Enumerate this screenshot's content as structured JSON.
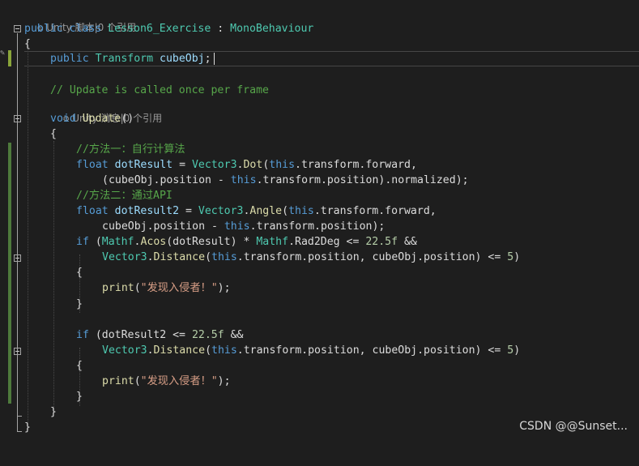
{
  "lens": {
    "class_refs": "Unity 脚本|0 个引用",
    "update_refs": "Unity 消息|0 个引用"
  },
  "code": {
    "class_decl": {
      "kw1": "public",
      "kw2": "class",
      "name": "Lesson6_Exercise",
      "colon": " : ",
      "base": "MonoBehaviour"
    },
    "open_brace": "{",
    "field": {
      "kw": "public",
      "type": "Transform",
      "name": "cubeObj",
      "semi": ";"
    },
    "comment_update": "// Update is called once per frame",
    "method": {
      "kw": "void",
      "name": "Update",
      "parens": "()"
    },
    "method_open": "{",
    "c1": "//方法一：自行计算法",
    "l_dot_1": {
      "kw": "float",
      "var": "dotResult",
      "eq": " = ",
      "type": "Vector3",
      "dot": ".",
      "fn": "Dot",
      "open": "(",
      "this": "this",
      "rest": ".transform.forward,"
    },
    "l_dot_2": {
      "text1": "(cubeObj.position - ",
      "this": "this",
      "text2": ".transform.position).normalized);"
    },
    "c2": "//方法二：通过API",
    "l_ang_1": {
      "kw": "float",
      "var": "dotResult2",
      "eq": " = ",
      "type": "Vector3",
      "dot": ".",
      "fn": "Angle",
      "open": "(",
      "this": "this",
      "rest": ".transform.forward,"
    },
    "l_ang_2": {
      "text1": "cubeObj.position - ",
      "this": "this",
      "text2": ".transform.position);"
    },
    "if1_a": {
      "kw": "if",
      "p1": " (",
      "type1": "Mathf",
      "dot1": ".",
      "fn1": "Acos",
      "p2": "(dotResult) * ",
      "type2": "Mathf",
      "rest": ".Rad2Deg <= ",
      "num": "22.5f",
      "tail": " &&"
    },
    "if1_b": {
      "type": "Vector3",
      "dot": ".",
      "fn": "Distance",
      "open": "(",
      "this": "this",
      "mid": ".transform.position, cubeObj.position) <= ",
      "num": "5",
      "close": ")"
    },
    "brace_open": "{",
    "print": {
      "fn": "print",
      "open": "(",
      "str": "\"发现入侵者！\"",
      "close": ");"
    },
    "brace_close": "}",
    "if2_a": {
      "kw": "if",
      "p1": " (dotResult2 <= ",
      "num": "22.5f",
      "tail": " &&"
    },
    "method_close": "}",
    "class_close": "}"
  },
  "watermark": "CSDN @@Sunset..."
}
